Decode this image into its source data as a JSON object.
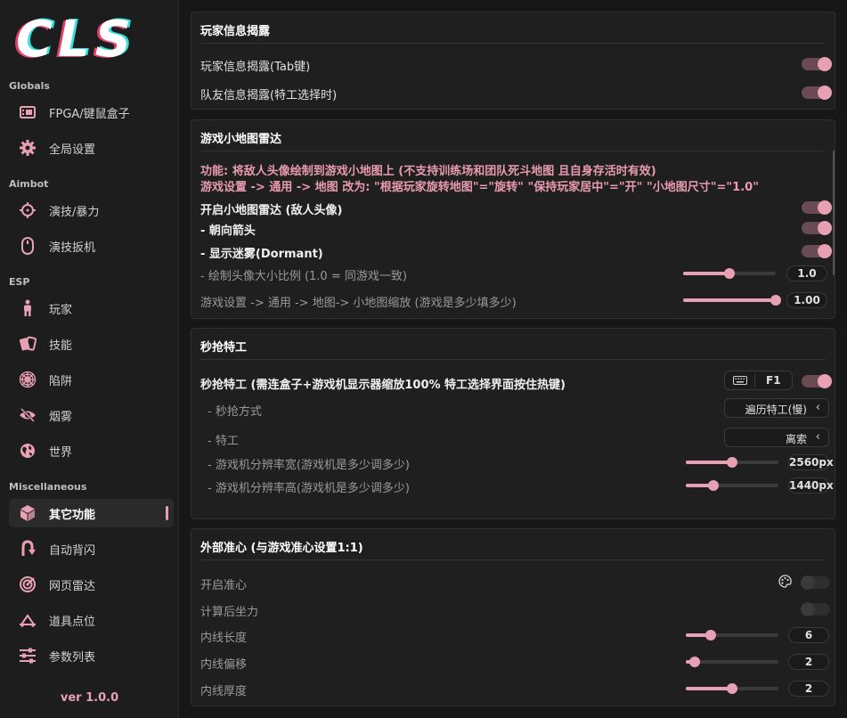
{
  "logo": {
    "text": "CLS"
  },
  "sidebar": {
    "groups": {
      "globals": "Globals",
      "aimbot": "Aimbot",
      "esp": "ESP",
      "misc": "Miscellaneous"
    },
    "items": [
      {
        "label": "FPGA/键鼠盒子",
        "icon": "gpu-card-icon"
      },
      {
        "label": "全局设置",
        "icon": "gear-icon"
      },
      {
        "label": "演技/暴力",
        "icon": "crosshair-icon"
      },
      {
        "label": "演技扳机",
        "icon": "mouse-icon"
      },
      {
        "label": "玩家",
        "icon": "person-icon"
      },
      {
        "label": "技能",
        "icon": "cards-icon"
      },
      {
        "label": "陷阱",
        "icon": "spiderweb-icon"
      },
      {
        "label": "烟雾",
        "icon": "eye-slash-icon"
      },
      {
        "label": "世界",
        "icon": "globe-icon"
      },
      {
        "label": "其它功能",
        "icon": "cube-icon",
        "active": true
      },
      {
        "label": "自动背闪",
        "icon": "u-turn-icon"
      },
      {
        "label": "网页雷达",
        "icon": "radar-icon"
      },
      {
        "label": "道具点位",
        "icon": "map-point-icon"
      },
      {
        "label": "参数列表",
        "icon": "sliders-icon"
      }
    ],
    "version": "ver 1.0.0"
  },
  "colors": {
    "accent": "#e8a0b4",
    "warning": "#e89ab0",
    "panel": "#1f1f1f"
  },
  "player_info": {
    "title": "玩家信息揭露",
    "rows": [
      {
        "label": "玩家信息揭露(Tab键)",
        "on": true
      },
      {
        "label": "队友信息揭露(特工选择时)",
        "on": true
      }
    ]
  },
  "minimap": {
    "title": "游戏小地图雷达",
    "warn1": "功能: 将敌人头像绘制到游戏小地图上 (不支持训练场和团队死斗地图 且自身存活时有效)",
    "warn2": "游戏设置 -> 通用 -> 地图 改为: \"根据玩家旋转地图\"=\"旋转\"   \"保持玩家居中\"=\"开\"   \"小地图尺寸\"=\"1.0\"",
    "enable": {
      "label": "开启小地图雷达 (敌人头像)",
      "on": true
    },
    "arrow": {
      "label": "- 朝向箭头",
      "on": true
    },
    "dormant": {
      "label": "- 显示迷雾(Dormant)",
      "on": true
    },
    "scale": {
      "label": "- 绘制头像大小比例 (1.0 = 同游戏一致)",
      "value": "1.0",
      "fraction": 0.5
    },
    "zoom": {
      "label": "游戏设置 -> 通用 -> 地图-> 小地图缩放 (游戏是多少填多少)",
      "value": "1.00",
      "fraction": 1.0
    }
  },
  "instalock": {
    "title": "秒抢特工",
    "enable": {
      "label": "秒抢特工 (需连盒子+游戏机显示器缩放100%  特工选择界面按住热键)",
      "hotkey": "F1",
      "on": true
    },
    "method": {
      "label": "- 秒抢方式",
      "value": "遍历特工(慢)"
    },
    "agent": {
      "label": "- 特工",
      "value": "离索"
    },
    "res_w": {
      "label": "- 游戏机分辨率宽(游戏机是多少调多少)",
      "value": "2560px",
      "fraction": 0.5
    },
    "res_h": {
      "label": "- 游戏机分辨率高(游戏机是多少调多少)",
      "value": "1440px",
      "fraction": 0.3
    }
  },
  "crosshair": {
    "title": "外部准心 (与游戏准心设置1:1)",
    "enable": {
      "label": "开启准心",
      "on": false
    },
    "recoil": {
      "label": "计算后坐力",
      "on": false
    },
    "inner_len": {
      "label": "内线长度",
      "value": "6",
      "fraction": 0.27
    },
    "inner_off": {
      "label": "内线偏移",
      "value": "2",
      "fraction": 0.1
    },
    "inner_thick": {
      "label": "内线厚度",
      "value": "2",
      "fraction": 0.5
    }
  }
}
